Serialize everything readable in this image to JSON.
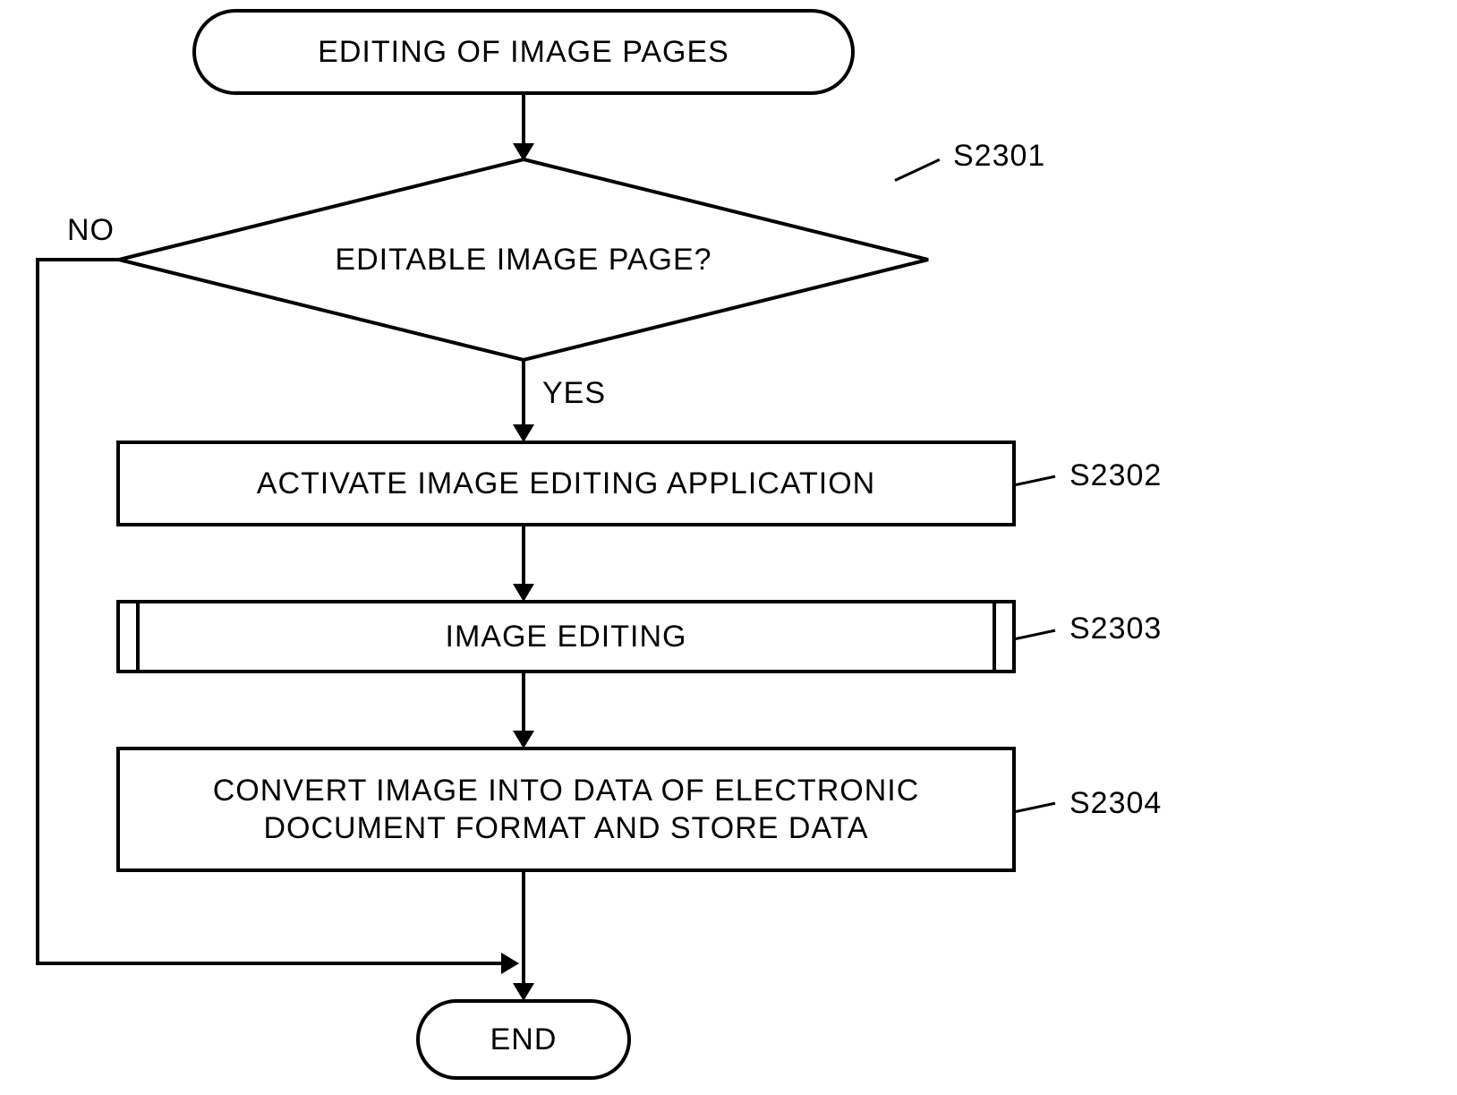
{
  "flowchart": {
    "title": "EDITING OF IMAGE PAGES",
    "decision": {
      "text": "EDITABLE IMAGE PAGE?",
      "ref": "S2301",
      "yes": "YES",
      "no": "NO"
    },
    "steps": [
      {
        "text": "ACTIVATE IMAGE EDITING APPLICATION",
        "ref": "S2302",
        "type": "process"
      },
      {
        "text": "IMAGE EDITING",
        "ref": "S2303",
        "type": "subprocess"
      },
      {
        "text": "CONVERT IMAGE INTO DATA OF ELECTRONIC DOCUMENT FORMAT AND STORE DATA",
        "ref": "S2304",
        "type": "process"
      }
    ],
    "end": "END"
  }
}
